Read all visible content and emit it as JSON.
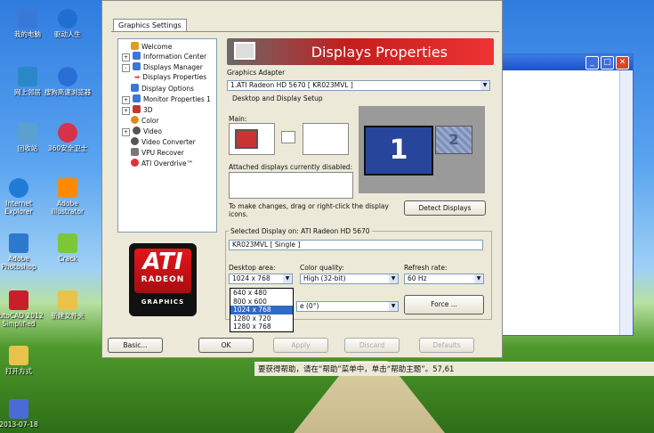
{
  "desktop": {
    "icons": [
      {
        "label": "我的电脑",
        "color": "#3a78d8"
      },
      {
        "label": "驱动人生",
        "color": "#1f6fd0"
      },
      {
        "label": "网上邻居",
        "color": "#2a88c8"
      },
      {
        "label": "搜狗高速浏览器",
        "color": "#2b6fd6"
      },
      {
        "label": "回收站",
        "color": "#5aa0d0"
      },
      {
        "label": "360安全卫士",
        "color": "#d8324a"
      },
      {
        "label": "Internet Explorer",
        "color": "#1f7ad8"
      },
      {
        "label": "Adobe Illustrator",
        "color": "#ff8a00"
      },
      {
        "label": "Adobe Photoshop",
        "color": "#2b7acb"
      },
      {
        "label": "Crack",
        "color": "#7cc63a"
      },
      {
        "label": "AutoCAD 2012 Simplified",
        "color": "#c8202a"
      },
      {
        "label": "新建文件夹",
        "color": "#e8c24a"
      },
      {
        "label": "打开方式",
        "color": "#e8c24a"
      },
      {
        "label": "2013-07-18",
        "color": "#4a6ad8"
      }
    ],
    "status_text": "要获得帮助，请在“帮助”菜单中，单击“帮助主题”。57,61"
  },
  "dialog": {
    "tab_label": "Graphics Settings",
    "tree": [
      {
        "label": "Welcome",
        "color": "#d9a21a",
        "pm": ""
      },
      {
        "label": "Information Center",
        "color": "#3a78d8",
        "pm": "+"
      },
      {
        "label": "Displays Manager",
        "color": "#3a78d8",
        "pm": "-"
      },
      {
        "label": "Displays Properties",
        "color": "#e33",
        "pm": ""
      },
      {
        "label": "Display Options",
        "color": "#3a78d8",
        "pm": ""
      },
      {
        "label": "Monitor Properties 1",
        "color": "#3a78d8",
        "pm": "+"
      },
      {
        "label": "3D",
        "color": "#c0392b",
        "pm": "+"
      },
      {
        "label": "Color",
        "color": "#e08a1a",
        "pm": ""
      },
      {
        "label": "Video",
        "color": "#555",
        "pm": "+"
      },
      {
        "label": "Video Converter",
        "color": "#555",
        "pm": ""
      },
      {
        "label": "VPU Recover",
        "color": "#777",
        "pm": ""
      },
      {
        "label": "ATI Overdrive™",
        "color": "#d33",
        "pm": ""
      }
    ],
    "logo": {
      "big": "ATI",
      "radeon": "RADEON",
      "graphics": "GRAPHICS"
    },
    "banner_title": "Displays Properties",
    "graphics_adapter_label": "Graphics Adapter",
    "graphics_adapter_value": "1.ATI Radeon HD 5670 [ KR023MVL ]",
    "desktop_setup_label": "Desktop and Display Setup",
    "main_label": "Main:",
    "attached_label": "Attached displays currently disabled:",
    "instruction": "To make changes, drag or right-click the display icons.",
    "detect_label": "Detect Displays",
    "display_one": "1",
    "display_two": "2",
    "selected_display_label": "Selected Display on: ATI Radeon HD 5670",
    "selected_display_value": "KR023MVL [ Single ]",
    "desktop_area_label": "Desktop area:",
    "desktop_area_value": "1024 x 768",
    "desktop_area_options": [
      "640 x 480",
      "800 x 600",
      "1024 x 768",
      "1280 x 720",
      "1280 x 768"
    ],
    "color_quality_label": "Color quality:",
    "color_quality_value": "High (32-bit)",
    "refresh_rate_label": "Refresh rate:",
    "refresh_rate_value": "60 Hz",
    "rotation_value": "e (0°)",
    "force_label": "Force ...",
    "buttons": {
      "basic": "Basic...",
      "ok": "OK",
      "apply": "Apply",
      "discard": "Discard",
      "defaults": "Defaults"
    }
  }
}
